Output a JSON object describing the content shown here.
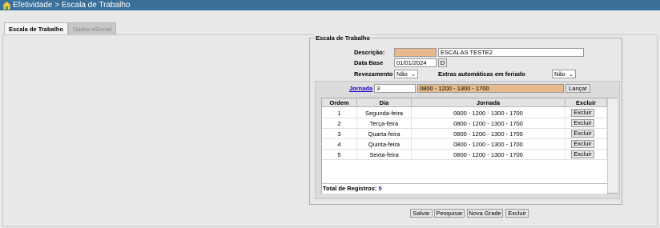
{
  "titlebar": {
    "title": "Efetividade > Escala de Trabalho"
  },
  "tabs": [
    {
      "label": "Escala de Trabalho"
    },
    {
      "label": "Dados eSocial"
    }
  ],
  "form": {
    "legend": "Escala de Trabalho",
    "descricao_label": "Descrição:",
    "descricao_value": "ESCALAS TESTE2",
    "data_base_label": "Data Base",
    "data_base_value": "01/01/2024",
    "data_base_button": "D",
    "revezamento_label": "Revezamento",
    "revezamento_value": "Não",
    "extras_label": "Extras automáticas em feriado",
    "extras_value": "Não",
    "jornada_label": "Jornada",
    "jornada_value": "3",
    "jornada_desc": "0800 - 1200 - 1300 - 1700",
    "lancar_button": "Lançar"
  },
  "grid": {
    "headers": [
      "Ordem",
      "Dia",
      "Jornada",
      "Excluir"
    ],
    "rows": [
      {
        "ordem": "1",
        "dia": "Segunda-feira",
        "jornada": "0800 - 1200 - 1300 - 1700",
        "excluir": "Excluir"
      },
      {
        "ordem": "2",
        "dia": "Terça-feira",
        "jornada": "0800 - 1200 - 1300 - 1700",
        "excluir": "Excluir"
      },
      {
        "ordem": "3",
        "dia": "Quarta-feira",
        "jornada": "0800 - 1200 - 1300 - 1700",
        "excluir": "Excluir"
      },
      {
        "ordem": "4",
        "dia": "Quinta-feira",
        "jornada": "0800 - 1200 - 1300 - 1700",
        "excluir": "Excluir"
      },
      {
        "ordem": "5",
        "dia": "Sexta-feira",
        "jornada": "0800 - 1200 - 1300 - 1700",
        "excluir": "Excluir"
      }
    ],
    "footer_label": "Total de Registros:",
    "footer_count": "5"
  },
  "actions": {
    "salvar": "Salvar",
    "pesquisar": "Pesquisar",
    "nova_grade": "Nova Grade",
    "excluir": "Excluir"
  },
  "colors": {
    "titlebar": "#3a6f9a",
    "highlight_field": "#e8b98a",
    "link": "#2200c8"
  },
  "icons": {
    "app": "home-icon"
  }
}
